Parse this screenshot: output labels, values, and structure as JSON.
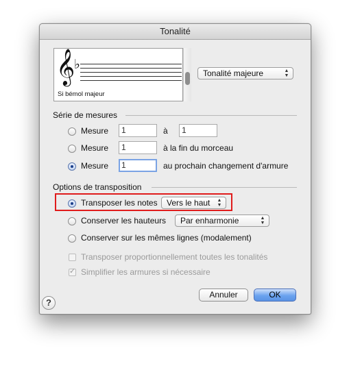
{
  "dialog": {
    "title": "Tonalité",
    "preview": {
      "caption": "Si bémol majeur",
      "clef": "treble-clef",
      "accidental": "flat",
      "scroll_fraction": 0.5
    },
    "mode_popup": {
      "value": "Tonalité majeure"
    },
    "measures": {
      "heading": "Série de mesures",
      "rows": [
        {
          "label": "Mesure",
          "from": "1",
          "mid_label": "à",
          "to": "1",
          "selected": false
        },
        {
          "label": "Mesure",
          "from": "1",
          "mid_label": "à la fin du morceau",
          "selected": false
        },
        {
          "label": "Mesure",
          "from": "1",
          "mid_label": "au prochain changement d'armure",
          "selected": true
        }
      ]
    },
    "transposition": {
      "heading": "Options de transposition",
      "options": [
        {
          "label": "Transposer les notes",
          "popup": "Vers le haut",
          "selected": true
        },
        {
          "label": "Conserver les hauteurs",
          "popup": "Par enharmonie",
          "selected": false
        },
        {
          "label": "Conserver sur les mêmes lignes (modalement)",
          "selected": false
        }
      ],
      "checkboxes": [
        {
          "label": "Transposer proportionnellement toutes les tonalités",
          "checked": false,
          "enabled": false
        },
        {
          "label": "Simplifier les armures si nécessaire",
          "checked": true,
          "enabled": false
        }
      ]
    },
    "buttons": {
      "cancel": "Annuler",
      "ok": "OK",
      "help": "?"
    },
    "highlight_color": "#e01b1b"
  }
}
